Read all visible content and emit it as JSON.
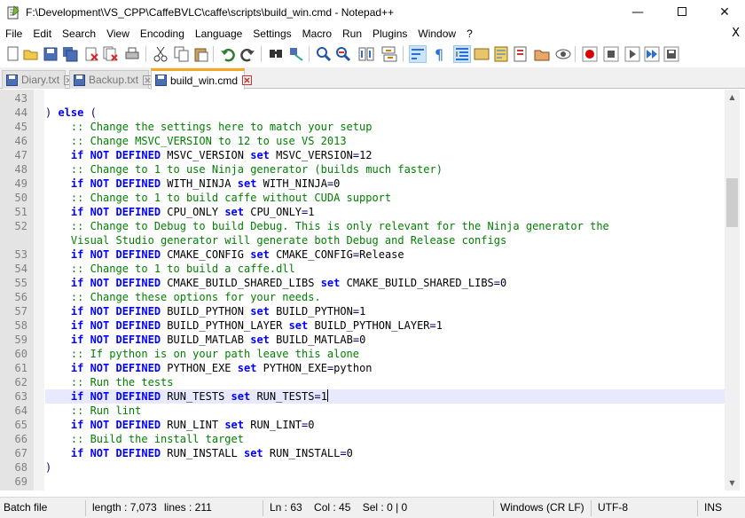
{
  "window": {
    "title": "F:\\Development\\VS_CPP\\CaffeBVLC\\caffe\\scripts\\build_win.cmd - Notepad++",
    "app_icon": "notepad-plus-plus-icon",
    "controls": [
      "minimize-icon",
      "maximize-icon",
      "close-icon"
    ]
  },
  "menu": {
    "items": [
      "File",
      "Edit",
      "Search",
      "View",
      "Encoding",
      "Language",
      "Settings",
      "Macro",
      "Run",
      "Plugins",
      "Window",
      "?"
    ],
    "close_label": "X"
  },
  "toolbar": {
    "icons": [
      "new-file-icon",
      "open-file-icon",
      "save-icon",
      "save-all-icon",
      "close-icon",
      "close-all-icon",
      "print-icon",
      "cut-icon",
      "copy-icon",
      "paste-icon",
      "undo-icon",
      "redo-icon",
      "find-icon",
      "replace-icon",
      "zoom-in-icon",
      "zoom-out-icon",
      "sync-vertical-icon",
      "sync-horizontal-icon",
      "word-wrap-icon",
      "show-all-characters-icon",
      "indent-guide-icon",
      "user-language-icon",
      "document-map-icon",
      "function-list-icon",
      "folder-workspace-icon",
      "monitoring-icon",
      "record-macro-icon",
      "stop-recording-icon",
      "play-macro-icon",
      "play-macro-multiple-icon",
      "save-macro-icon"
    ]
  },
  "tabs": [
    {
      "label": "Diary.txt",
      "icon": "file-saved-icon",
      "active": false
    },
    {
      "label": "Backup.txt",
      "icon": "file-saved-icon",
      "active": false
    },
    {
      "label": "build_win.cmd",
      "icon": "file-saved-icon",
      "active": true
    }
  ],
  "editor": {
    "current_line_number": "63",
    "lines": [
      {
        "num": "43",
        "tokens": []
      },
      {
        "num": "44",
        "tokens": [
          {
            "t": "op",
            "v": ") "
          },
          {
            "t": "kw",
            "v": "else"
          },
          {
            "t": "op",
            "v": " ("
          }
        ]
      },
      {
        "num": "45",
        "tokens": [
          {
            "t": "cm",
            "v": "    :: Change the settings here to match your setup"
          }
        ]
      },
      {
        "num": "46",
        "tokens": [
          {
            "t": "cm",
            "v": "    :: Change MSVC_VERSION to 12 to use VS 2013"
          }
        ]
      },
      {
        "num": "47",
        "tokens": [
          {
            "t": "tx",
            "v": "    "
          },
          {
            "t": "kw",
            "v": "if NOT DEFINED"
          },
          {
            "t": "tx",
            "v": " MSVC_VERSION "
          },
          {
            "t": "kw",
            "v": "set"
          },
          {
            "t": "tx",
            "v": " MSVC_VERSION"
          },
          {
            "t": "op",
            "v": "="
          },
          {
            "t": "tx",
            "v": "12"
          }
        ]
      },
      {
        "num": "48",
        "tokens": [
          {
            "t": "cm",
            "v": "    :: Change to 1 to use Ninja generator (builds much faster)"
          }
        ]
      },
      {
        "num": "49",
        "tokens": [
          {
            "t": "tx",
            "v": "    "
          },
          {
            "t": "kw",
            "v": "if NOT DEFINED"
          },
          {
            "t": "tx",
            "v": " WITH_NINJA "
          },
          {
            "t": "kw",
            "v": "set"
          },
          {
            "t": "tx",
            "v": " WITH_NINJA"
          },
          {
            "t": "op",
            "v": "="
          },
          {
            "t": "tx",
            "v": "0"
          }
        ]
      },
      {
        "num": "50",
        "tokens": [
          {
            "t": "cm",
            "v": "    :: Change to 1 to build caffe without CUDA support"
          }
        ]
      },
      {
        "num": "51",
        "tokens": [
          {
            "t": "tx",
            "v": "    "
          },
          {
            "t": "kw",
            "v": "if NOT DEFINED"
          },
          {
            "t": "tx",
            "v": " CPU_ONLY "
          },
          {
            "t": "kw",
            "v": "set"
          },
          {
            "t": "tx",
            "v": " CPU_ONLY"
          },
          {
            "t": "op",
            "v": "="
          },
          {
            "t": "tx",
            "v": "1"
          }
        ]
      },
      {
        "num": "52",
        "tokens": [
          {
            "t": "cm",
            "v": "    :: Change to Debug to build Debug. This is only relevant for the Ninja generator the"
          }
        ]
      },
      {
        "num": "",
        "tokens": [
          {
            "t": "cm",
            "v": "    Visual Studio generator will generate both Debug and Release configs"
          }
        ]
      },
      {
        "num": "53",
        "tokens": [
          {
            "t": "tx",
            "v": "    "
          },
          {
            "t": "kw",
            "v": "if NOT DEFINED"
          },
          {
            "t": "tx",
            "v": " CMAKE_CONFIG "
          },
          {
            "t": "kw",
            "v": "set"
          },
          {
            "t": "tx",
            "v": " CMAKE_CONFIG"
          },
          {
            "t": "op",
            "v": "="
          },
          {
            "t": "tx",
            "v": "Release"
          }
        ]
      },
      {
        "num": "54",
        "tokens": [
          {
            "t": "cm",
            "v": "    :: Change to 1 to build a caffe.dll"
          }
        ]
      },
      {
        "num": "55",
        "tokens": [
          {
            "t": "tx",
            "v": "    "
          },
          {
            "t": "kw",
            "v": "if NOT DEFINED"
          },
          {
            "t": "tx",
            "v": " CMAKE_BUILD_SHARED_LIBS "
          },
          {
            "t": "kw",
            "v": "set"
          },
          {
            "t": "tx",
            "v": " CMAKE_BUILD_SHARED_LIBS"
          },
          {
            "t": "op",
            "v": "="
          },
          {
            "t": "tx",
            "v": "0"
          }
        ]
      },
      {
        "num": "56",
        "tokens": [
          {
            "t": "cm",
            "v": "    :: Change these options for your needs."
          }
        ]
      },
      {
        "num": "57",
        "tokens": [
          {
            "t": "tx",
            "v": "    "
          },
          {
            "t": "kw",
            "v": "if NOT DEFINED"
          },
          {
            "t": "tx",
            "v": " BUILD_PYTHON "
          },
          {
            "t": "kw",
            "v": "set"
          },
          {
            "t": "tx",
            "v": " BUILD_PYTHON"
          },
          {
            "t": "op",
            "v": "="
          },
          {
            "t": "tx",
            "v": "1"
          }
        ]
      },
      {
        "num": "58",
        "tokens": [
          {
            "t": "tx",
            "v": "    "
          },
          {
            "t": "kw",
            "v": "if NOT DEFINED"
          },
          {
            "t": "tx",
            "v": " BUILD_PYTHON_LAYER "
          },
          {
            "t": "kw",
            "v": "set"
          },
          {
            "t": "tx",
            "v": " BUILD_PYTHON_LAYER"
          },
          {
            "t": "op",
            "v": "="
          },
          {
            "t": "tx",
            "v": "1"
          }
        ]
      },
      {
        "num": "59",
        "tokens": [
          {
            "t": "tx",
            "v": "    "
          },
          {
            "t": "kw",
            "v": "if NOT DEFINED"
          },
          {
            "t": "tx",
            "v": " BUILD_MATLAB "
          },
          {
            "t": "kw",
            "v": "set"
          },
          {
            "t": "tx",
            "v": " BUILD_MATLAB"
          },
          {
            "t": "op",
            "v": "="
          },
          {
            "t": "tx",
            "v": "0"
          }
        ]
      },
      {
        "num": "60",
        "tokens": [
          {
            "t": "cm",
            "v": "    :: If python is on your path leave this alone"
          }
        ]
      },
      {
        "num": "61",
        "tokens": [
          {
            "t": "tx",
            "v": "    "
          },
          {
            "t": "kw",
            "v": "if NOT DEFINED"
          },
          {
            "t": "tx",
            "v": " PYTHON_EXE "
          },
          {
            "t": "kw",
            "v": "set"
          },
          {
            "t": "tx",
            "v": " PYTHON_EXE"
          },
          {
            "t": "op",
            "v": "="
          },
          {
            "t": "tx",
            "v": "python"
          }
        ]
      },
      {
        "num": "62",
        "tokens": [
          {
            "t": "cm",
            "v": "    :: Run the tests"
          }
        ]
      },
      {
        "num": "63",
        "tokens": [
          {
            "t": "tx",
            "v": "    "
          },
          {
            "t": "kw",
            "v": "if NOT DEFINED"
          },
          {
            "t": "tx",
            "v": " RUN_TESTS "
          },
          {
            "t": "kw",
            "v": "set"
          },
          {
            "t": "tx",
            "v": " RUN_TESTS"
          },
          {
            "t": "op",
            "v": "="
          },
          {
            "t": "tx",
            "v": "1"
          },
          {
            "t": "caret",
            "v": ""
          }
        ]
      },
      {
        "num": "64",
        "tokens": [
          {
            "t": "cm",
            "v": "    :: Run lint"
          }
        ]
      },
      {
        "num": "65",
        "tokens": [
          {
            "t": "tx",
            "v": "    "
          },
          {
            "t": "kw",
            "v": "if NOT DEFINED"
          },
          {
            "t": "tx",
            "v": " RUN_LINT "
          },
          {
            "t": "kw",
            "v": "set"
          },
          {
            "t": "tx",
            "v": " RUN_LINT"
          },
          {
            "t": "op",
            "v": "="
          },
          {
            "t": "tx",
            "v": "0"
          }
        ]
      },
      {
        "num": "66",
        "tokens": [
          {
            "t": "cm",
            "v": "    :: Build the install target"
          }
        ]
      },
      {
        "num": "67",
        "tokens": [
          {
            "t": "tx",
            "v": "    "
          },
          {
            "t": "kw",
            "v": "if NOT DEFINED"
          },
          {
            "t": "tx",
            "v": " RUN_INSTALL "
          },
          {
            "t": "kw",
            "v": "set"
          },
          {
            "t": "tx",
            "v": " RUN_INSTALL"
          },
          {
            "t": "op",
            "v": "="
          },
          {
            "t": "tx",
            "v": "0"
          }
        ]
      },
      {
        "num": "68",
        "tokens": [
          {
            "t": "op",
            "v": ")"
          }
        ]
      },
      {
        "num": "69",
        "tokens": []
      }
    ]
  },
  "status": {
    "file_type": "Batch file",
    "length": "length : 7,073",
    "lines": "lines : 211",
    "position": "Ln : 63    Col : 45    Sel : 0 | 0",
    "eol": "Windows (CR LF)",
    "encoding": "UTF-8",
    "insert_mode": "INS"
  },
  "colors": {
    "keyword": "#0000ff",
    "comment": "#008000",
    "operator": "#000080",
    "current_line": "#e8e8ff",
    "active_tab_accent": "#f5a623"
  }
}
